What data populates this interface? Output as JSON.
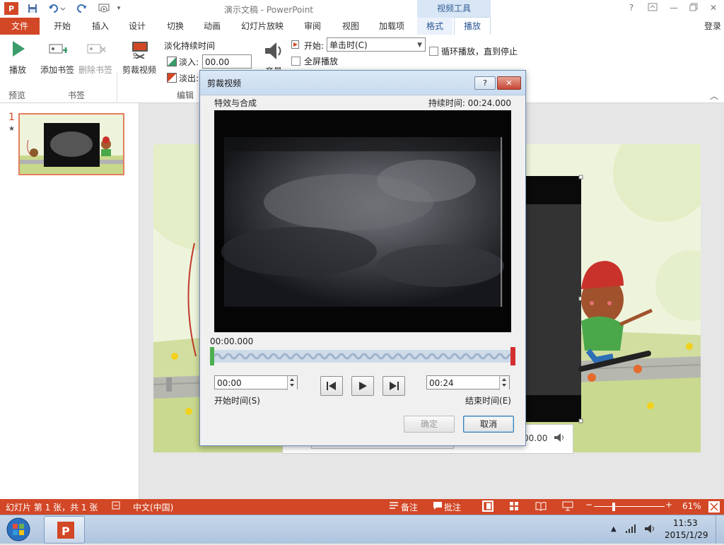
{
  "window": {
    "title": "演示文稿 - PowerPoint",
    "context_group": "视频工具",
    "help": "?",
    "signin": "登录"
  },
  "tabs": [
    {
      "label": "文件"
    },
    {
      "label": "开始"
    },
    {
      "label": "插入"
    },
    {
      "label": "设计"
    },
    {
      "label": "切换"
    },
    {
      "label": "动画"
    },
    {
      "label": "幻灯片放映"
    },
    {
      "label": "审阅"
    },
    {
      "label": "视图"
    },
    {
      "label": "加载项"
    },
    {
      "label": "格式"
    },
    {
      "label": "播放"
    }
  ],
  "ribbon": {
    "play": "播放",
    "add_bookmark": "添加书签",
    "remove_bookmark": "删除书签",
    "trim_video": "剪裁视频",
    "fade_duration": "淡化持续时间",
    "fade_in": "淡入:",
    "fade_in_value": "00.00",
    "fade_out": "淡出:",
    "volume": "音量",
    "start_label": "开始:",
    "start_value": "单击时(C)",
    "fullscreen": "全屏播放",
    "loop": "循环播放，直到停止",
    "groups": {
      "preview": "预览",
      "bookmarks": "书签",
      "editing": "编辑"
    }
  },
  "thumbnails": {
    "slide_number": "1",
    "star": "★"
  },
  "dialog": {
    "title": "剪裁视频",
    "help": "?",
    "close": "✕",
    "media_name": "特效与合成",
    "duration": "持续时间: 00:24.000",
    "current_time": "00:00.000",
    "start_time_value": "00:00",
    "start_time_label": "开始时间(S)",
    "end_time_value": "00:24",
    "end_time_label": "结束时间(E)",
    "ok": "确定",
    "cancel": "取消"
  },
  "player": {
    "time": "00.00"
  },
  "status": {
    "slide_info": "幻灯片 第 1 张，共 1 张",
    "language": "中文(中国)",
    "notes": "备注",
    "comments": "批注",
    "zoom": "61%"
  },
  "taskbar": {
    "time": "11:53",
    "date": "2015/1/29"
  },
  "colors": {
    "accent": "#d24726",
    "context": "#2b5797"
  }
}
